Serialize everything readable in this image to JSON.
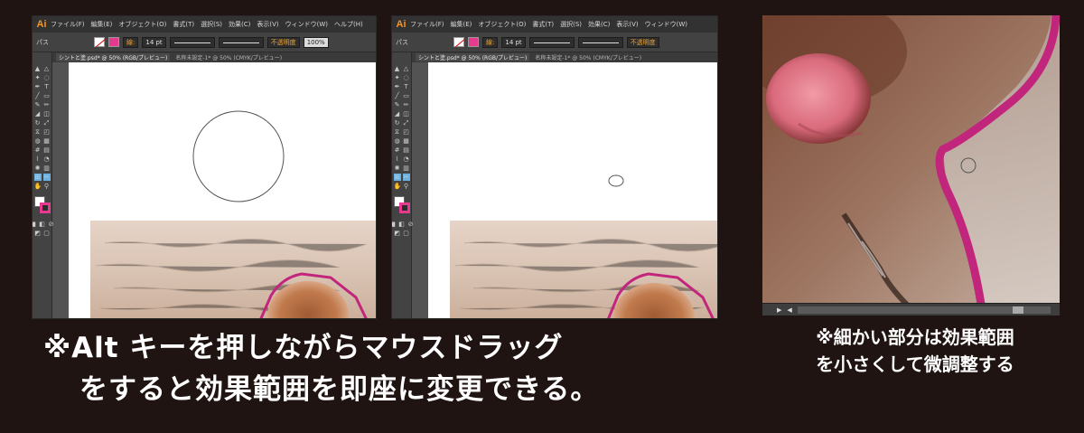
{
  "app": {
    "logo": "Ai",
    "menu": [
      "ファイル(F)",
      "編集(E)",
      "オブジェクト(O)",
      "書式(T)",
      "選択(S)",
      "効果(C)",
      "表示(V)",
      "ウィンドウ(W)",
      "ヘルプ(H)"
    ]
  },
  "control_bar": {
    "label": "パス",
    "stroke_label": "線:",
    "stroke_weight": "14 pt",
    "stroke_profile": "均等",
    "brush": "基本",
    "opacity_label": "不透明度",
    "opacity_value": "100%"
  },
  "left_window": {
    "tabs": [
      "シントと塗.psd* @ 50% (RGB/プレビュー)",
      "名称未設定-1* @ 50% (CMYK/プレビュー)"
    ]
  },
  "right_window": {
    "tabs": [
      "シントと塗.psd* @ 50% (RGB/プレビュー)",
      "名称未設定-1* @ 50% (CMYK/プレビュー)"
    ]
  },
  "captions": {
    "main_line1": "※Alt キーを押しながらマウスドラッグ",
    "main_line2": "をすると効果範囲を即座に変更できる。",
    "side_line1": "※細かい部分は効果範囲",
    "side_line2": "を小さくして微調整する"
  },
  "colors": {
    "background": "#1f1412",
    "accent_magenta": "#c2267c",
    "ai_orange": "#f7941d"
  },
  "icons": [
    "selection-tool-icon",
    "pen-tool-icon",
    "type-tool-icon",
    "brush-tool-icon",
    "zoom-tool-icon",
    "hand-tool-icon"
  ]
}
